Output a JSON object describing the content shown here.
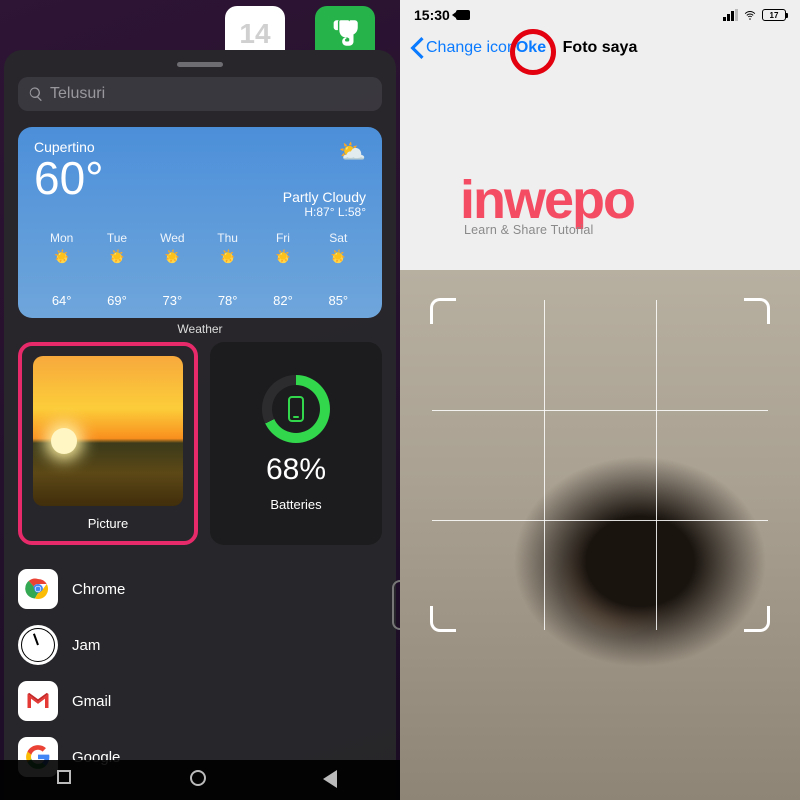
{
  "left": {
    "home_apps": {
      "calendar_day": "14"
    },
    "search": {
      "placeholder": "Telusuri"
    },
    "weather": {
      "location": "Cupertino",
      "temp": "60°",
      "condition": "Partly Cloudy",
      "hi_lo": "H:87° L:58°",
      "label": "Weather",
      "days": [
        {
          "label": "Mon",
          "temp": "64°"
        },
        {
          "label": "Tue",
          "temp": "69°"
        },
        {
          "label": "Wed",
          "temp": "73°"
        },
        {
          "label": "Thu",
          "temp": "78°"
        },
        {
          "label": "Fri",
          "temp": "82°"
        },
        {
          "label": "Sat",
          "temp": "85°"
        }
      ]
    },
    "widgets": {
      "picture_label": "Picture",
      "battery_label": "Batteries",
      "battery_pct": "68%"
    },
    "apps": [
      {
        "name": "Chrome",
        "icon": "chrome-icon"
      },
      {
        "name": "Jam",
        "icon": "clock-icon"
      },
      {
        "name": "Gmail",
        "icon": "gmail-icon"
      },
      {
        "name": "Google",
        "icon": "google-icon"
      }
    ]
  },
  "right": {
    "status": {
      "time": "15:30",
      "battery_text": "17"
    },
    "nav": {
      "back": "Change icon",
      "title": "Foto saya",
      "done": "Oke"
    },
    "brand": {
      "logo": "inwepo",
      "tagline": "Learn & Share Tutorial"
    }
  },
  "annotations": {
    "highlight_color": "#e62a6a",
    "circle_color": "#e3000f"
  }
}
